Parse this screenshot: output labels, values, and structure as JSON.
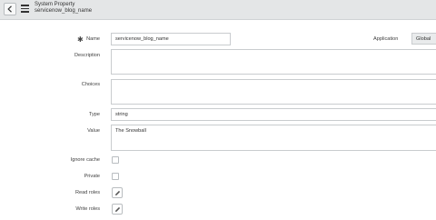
{
  "header": {
    "title": "System Property",
    "subtitle": "servicenow_blog_name"
  },
  "form": {
    "name_label": "Name",
    "name_value": "servicenow_blog_name",
    "application_label": "Application",
    "application_value": "Global",
    "description_label": "Description",
    "description_value": "",
    "choices_label": "Choices",
    "choices_value": "",
    "type_label": "Type",
    "type_value": "string",
    "value_label": "Value",
    "value_value": "The Snowball",
    "ignore_cache_label": "Ignore cache",
    "ignore_cache_checked": false,
    "private_label": "Private",
    "private_checked": false,
    "read_roles_label": "Read roles",
    "write_roles_label": "Write roles"
  },
  "icons": {
    "back": "chevron-left-icon",
    "menu": "hamburger-menu-icon",
    "required": "asterisk-icon",
    "read_roles": "pencil-icon",
    "write_roles": "pencil-icon"
  }
}
